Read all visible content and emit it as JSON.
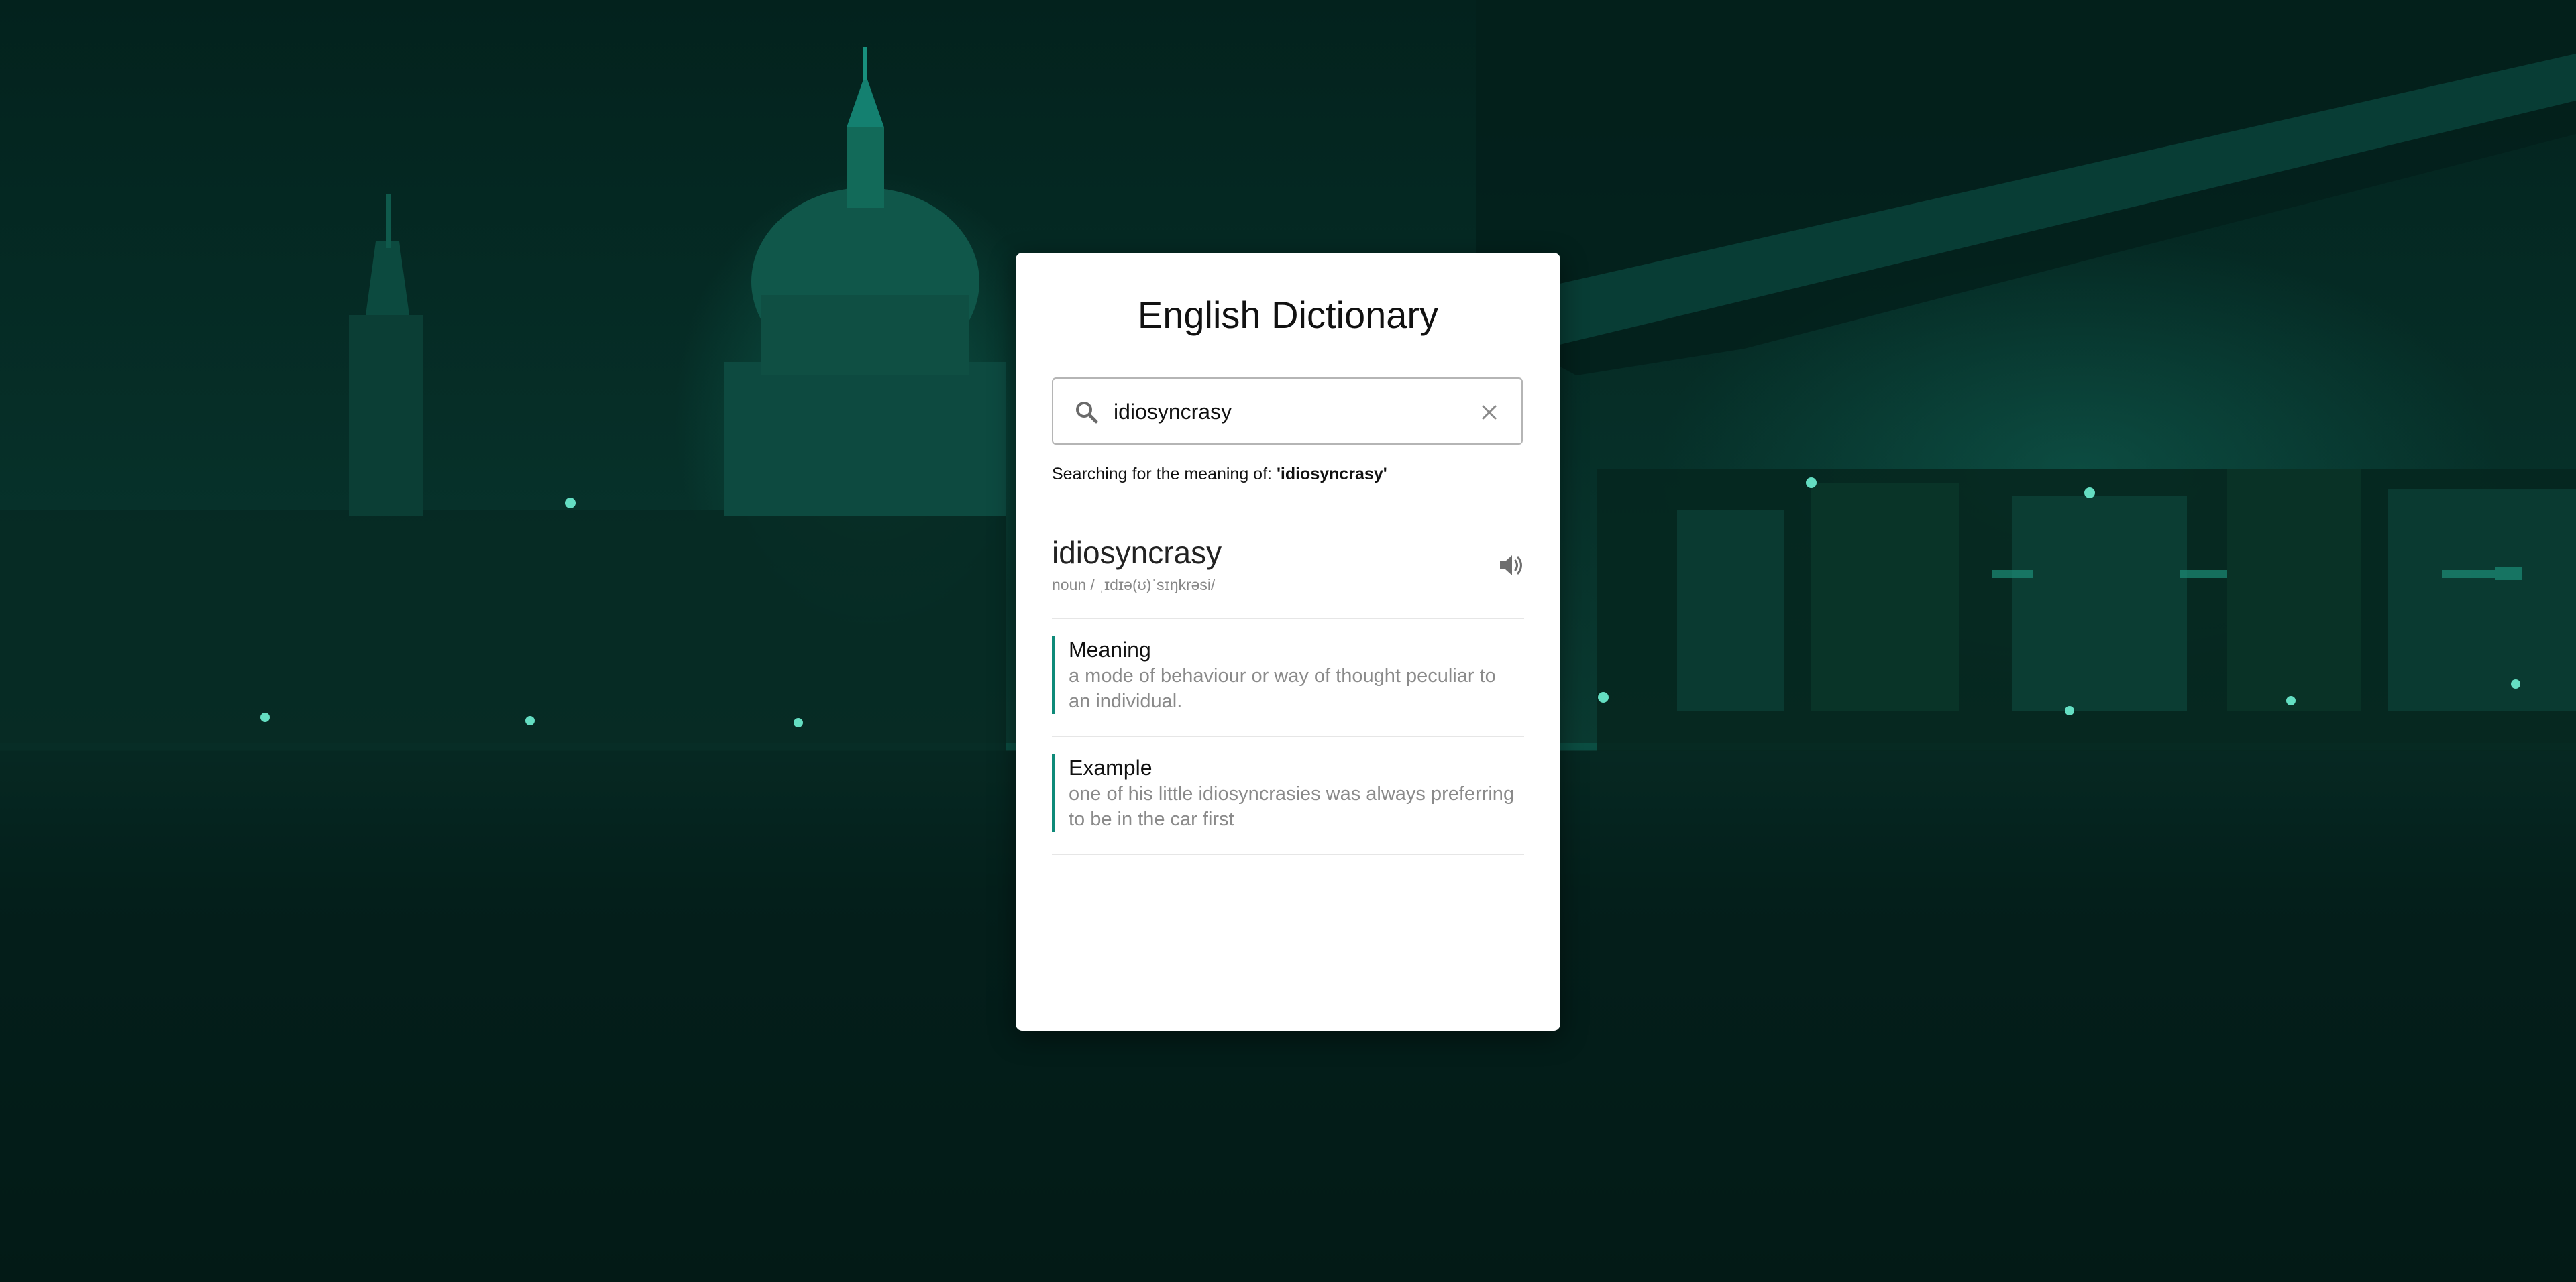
{
  "app": {
    "title": "English Dictionary"
  },
  "search": {
    "value": "idiosyncrasy",
    "search_icon": "search-icon",
    "clear_icon": "close-icon"
  },
  "status": {
    "prefix": "Searching for the meaning of: ",
    "term": "'idiosyncrasy'"
  },
  "result": {
    "word": "idiosyncrasy",
    "phonetic": "noun / ˌɪdɪə(ʊ)ˈsɪŋkrəsi/",
    "speaker_icon": "speaker-icon",
    "meaning": {
      "label": "Meaning",
      "text": "a mode of behaviour or way of thought peculiar to an individual."
    },
    "example": {
      "label": "Example",
      "text": "one of his little idiosyncrasies was always preferring to be in the car first"
    }
  },
  "colors": {
    "accent": "#0f8a79",
    "background": "#062f28",
    "card": "#ffffff"
  }
}
